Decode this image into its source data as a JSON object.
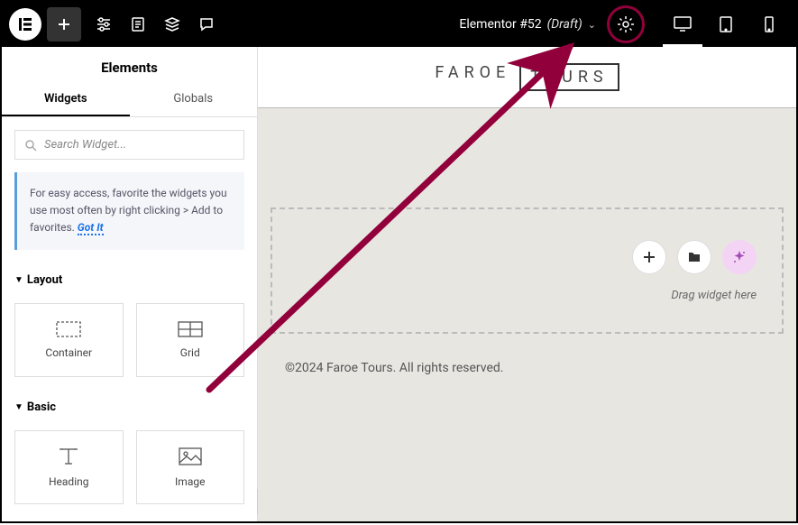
{
  "topbar": {
    "page_name": "Elementor #52",
    "draft_label": "(Draft)"
  },
  "sidebar": {
    "title": "Elements",
    "tabs": {
      "widgets": "Widgets",
      "globals": "Globals"
    },
    "search_placeholder": "Search Widget...",
    "tip_text": "For easy access, favorite the widgets you use most often by right clicking > Add to favorites. ",
    "tip_action": "Got It",
    "sections": {
      "layout": {
        "title": "Layout",
        "items": {
          "container": "Container",
          "grid": "Grid"
        }
      },
      "basic": {
        "title": "Basic",
        "items": {
          "heading": "Heading",
          "image": "Image"
        }
      }
    }
  },
  "canvas": {
    "brand_left": "FAROE",
    "brand_right": "TOURS",
    "drop_text": "Drag widget here",
    "footer": "©2024 Faroe Tours. All rights reserved."
  }
}
